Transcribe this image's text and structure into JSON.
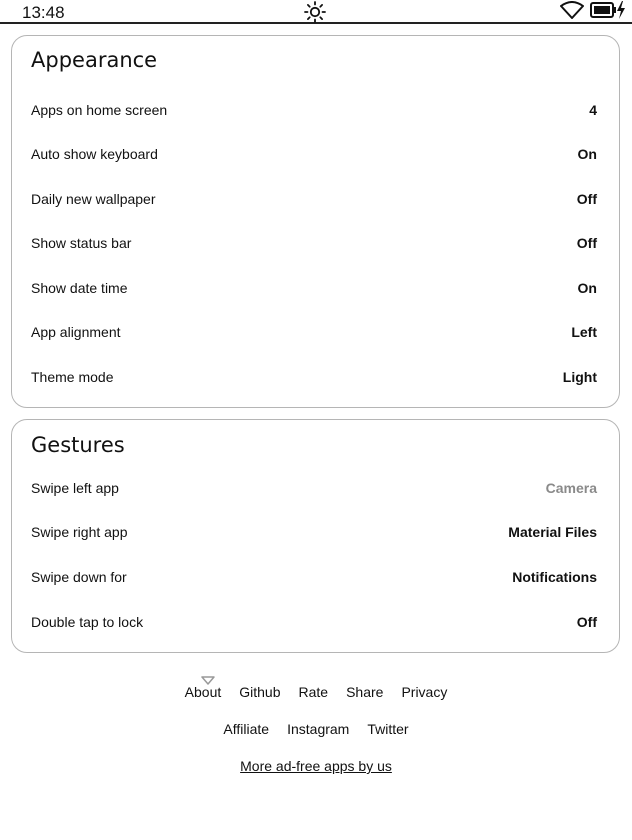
{
  "status_bar": {
    "time": "13:48",
    "center_icon": "brightness-sun-icon",
    "right_icons": [
      "wifi-icon",
      "battery-charging-icon"
    ]
  },
  "appearance": {
    "title": "Appearance",
    "rows": [
      {
        "label": "Apps on home screen",
        "value": "4"
      },
      {
        "label": "Auto show keyboard",
        "value": "On"
      },
      {
        "label": "Daily new wallpaper",
        "value": "Off"
      },
      {
        "label": "Show status bar",
        "value": "Off"
      },
      {
        "label": "Show date time",
        "value": "On"
      },
      {
        "label": "App alignment",
        "value": "Left"
      },
      {
        "label": "Theme mode",
        "value": "Light"
      }
    ]
  },
  "gestures": {
    "title": "Gestures",
    "rows": [
      {
        "label": "Swipe left app",
        "value": "Camera"
      },
      {
        "label": "Swipe right app",
        "value": "Material Files"
      },
      {
        "label": "Swipe down for",
        "value": "Notifications"
      },
      {
        "label": "Double tap to lock",
        "value": "Off"
      }
    ]
  },
  "footer": {
    "links_row1": [
      "About",
      "Github",
      "Rate",
      "Share",
      "Privacy"
    ],
    "links_row2": [
      "Affiliate",
      "Instagram",
      "Twitter"
    ],
    "more_link": "More ad-free apps by us",
    "about_marker_icon": "chevron-down-icon"
  },
  "colors": {
    "text": "#111111",
    "muted_value": "#8a8a8a",
    "card_border": "#b5b5b5",
    "background": "#ffffff"
  }
}
